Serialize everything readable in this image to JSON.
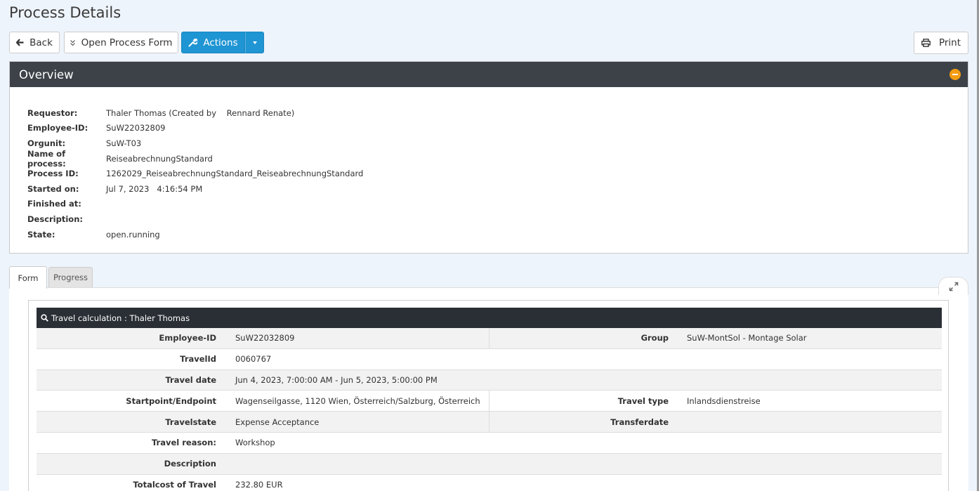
{
  "page": {
    "title": "Process Details"
  },
  "toolbar": {
    "back_label": "Back",
    "open_form_label": "Open Process Form",
    "actions_label": "Actions",
    "print_label": "Print"
  },
  "colors": {
    "primary": "#1f95d3",
    "header_dark": "#3c4248",
    "collapse_accent": "#f39c12",
    "table_header": "#2a2f35"
  },
  "overview": {
    "title": "Overview",
    "rows": [
      {
        "label": "Requestor:",
        "value": "Thaler Thomas (Created by    Rennard Renate)"
      },
      {
        "label": "Employee-ID:",
        "value": "SuW22032809"
      },
      {
        "label": "Orgunit:",
        "value": "SuW-T03"
      },
      {
        "label": "Name of process:",
        "value": "ReiseabrechnungStandard"
      },
      {
        "label": "Process ID:",
        "value": "1262029_ReiseabrechnungStandard_ReiseabrechnungStandard"
      },
      {
        "label": "Started on:",
        "value": "Jul 7, 2023   4:16:54 PM"
      },
      {
        "label": "Finished at:",
        "value": ""
      },
      {
        "label": "Description:",
        "value": ""
      },
      {
        "label": "State:",
        "value": "open.running"
      }
    ]
  },
  "tabs": [
    {
      "label": "Form"
    },
    {
      "label": "Progress"
    }
  ],
  "travel": {
    "header": "Travel calculation : Thaler Thomas",
    "rows": [
      {
        "label": "Employee-ID",
        "value": "SuW22032809",
        "label2": "Group",
        "value2": "SuW-MontSol - Montage Solar"
      },
      {
        "label": "TravelId",
        "value": "0060767"
      },
      {
        "label": "Travel date",
        "value": "Jun 4, 2023, 7:00:00 AM - Jun 5, 2023, 5:00:00 PM"
      },
      {
        "label": "Startpoint/Endpoint",
        "value": "Wagenseilgasse, 1120 Wien, Österreich/Salzburg, Österreich",
        "label2": "Travel type",
        "value2": "Inlandsdienstreise"
      },
      {
        "label": "Travelstate",
        "value": "Expense Acceptance",
        "label2": "Transferdate",
        "value2": ""
      },
      {
        "label": "Travel reason:",
        "value": "Workshop"
      },
      {
        "label": "Description",
        "value": ""
      },
      {
        "label": "Totalcost of Travel",
        "value": "232.80 EUR"
      }
    ]
  }
}
